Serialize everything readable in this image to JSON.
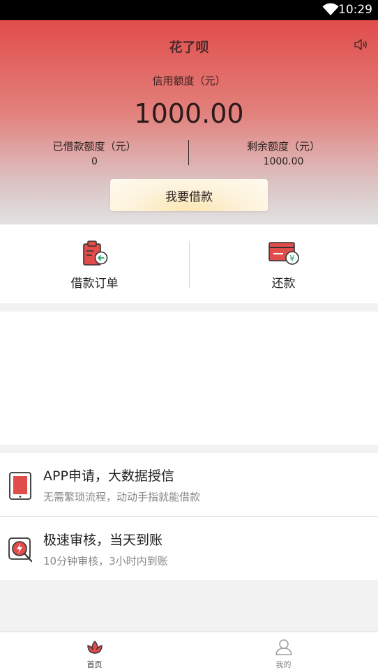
{
  "status_bar": {
    "time": "10:29",
    "icon": "wifi-icon"
  },
  "header": {
    "title": "花了呗",
    "speaker_icon": "speaker-icon"
  },
  "credit": {
    "label": "信用额度（元）",
    "value": "1000.00",
    "borrowed_label": "已借款额度（元）",
    "borrowed_value": "0",
    "remaining_label": "剩余额度（元）",
    "remaining_value": "1000.00",
    "borrow_button": "我要借款"
  },
  "actions": [
    {
      "label": "借款订单",
      "icon": "clipboard-icon"
    },
    {
      "label": "还款",
      "icon": "card-yuan-icon"
    }
  ],
  "features": [
    {
      "title": "APP申请，大数据授信",
      "desc": "无需繁琐流程，动动手指就能借款",
      "icon": "tablet-icon"
    },
    {
      "title": "极速审核，当天到账",
      "desc": "10分钟审核，3小时内到账",
      "icon": "lightning-search-icon"
    }
  ],
  "tabbar": [
    {
      "label": "首页",
      "icon": "flower-home-icon",
      "active": true
    },
    {
      "label": "我的",
      "icon": "person-icon",
      "active": false
    }
  ],
  "colors": {
    "brand_red": "#e14d4b",
    "accent_teal": "#2aa56a"
  }
}
